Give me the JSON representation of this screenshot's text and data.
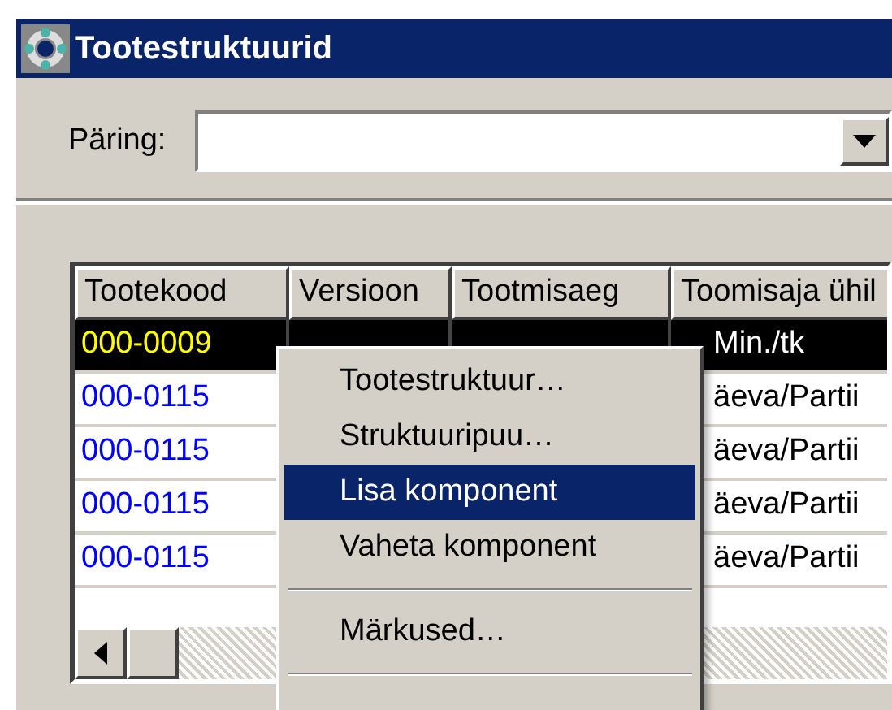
{
  "window": {
    "title": "Tootestruktuurid"
  },
  "query": {
    "label": "Päring:"
  },
  "table": {
    "columns": [
      "Tootekood",
      "Versioon",
      "Tootmisaeg",
      "Toomisaja ühil"
    ],
    "rows": [
      {
        "selected": true,
        "code": "000-0009",
        "unit": "Min./tk"
      },
      {
        "selected": false,
        "code": "000-0115",
        "unit": "äeva/Partii"
      },
      {
        "selected": false,
        "code": "000-0115",
        "unit": "äeva/Partii"
      },
      {
        "selected": false,
        "code": "000-0115",
        "unit": "äeva/Partii"
      },
      {
        "selected": false,
        "code": "000-0115",
        "unit": "äeva/Partii"
      }
    ]
  },
  "context_menu": {
    "items": [
      {
        "kind": "item",
        "label": "Tootestruktuur…",
        "selected": false
      },
      {
        "kind": "item",
        "label": "Struktuuripuu…",
        "selected": false
      },
      {
        "kind": "item",
        "label": "Lisa komponent",
        "selected": true
      },
      {
        "kind": "item",
        "label": "Vaheta komponent",
        "selected": false
      },
      {
        "kind": "separator"
      },
      {
        "kind": "item",
        "label": "Märkused…",
        "selected": false
      },
      {
        "kind": "separator"
      }
    ]
  }
}
